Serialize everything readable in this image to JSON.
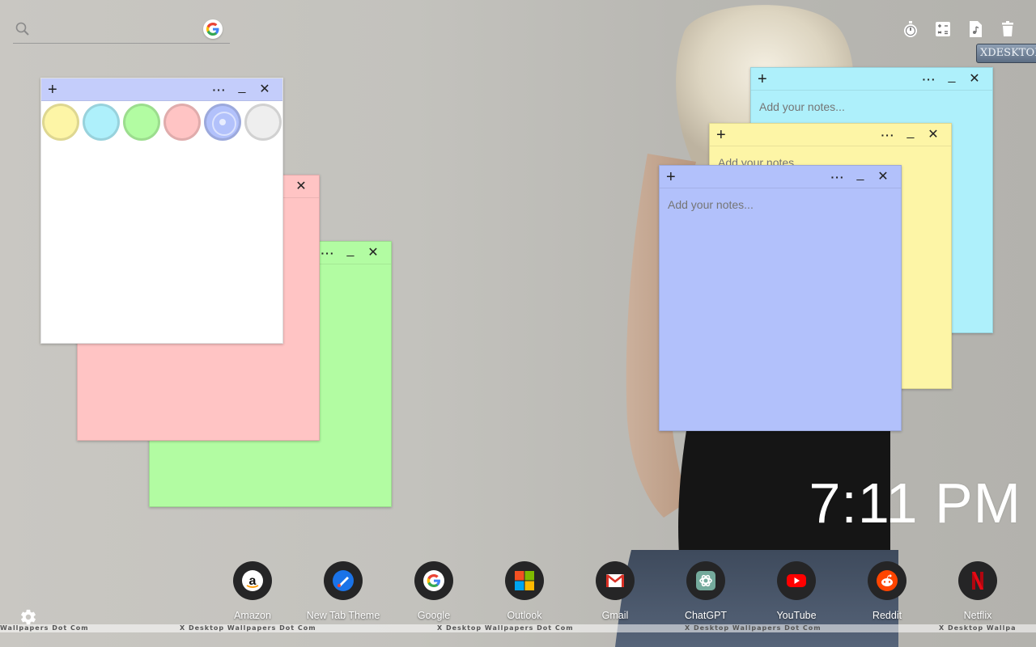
{
  "search": {
    "placeholder": ""
  },
  "watermark": {
    "logo": "XDESKTOP WALLPAPERS",
    "texts": [
      "Wallpapers Dot Com",
      "X Desktop Wallpapers Dot Com",
      "X Desktop Wallpapers Dot Com",
      "X Desktop Wallpapers Dot Com",
      "X Desktop Wallpa"
    ]
  },
  "top_tools": [
    "stopwatch-icon",
    "calculator-icon",
    "file-music-icon",
    "trash-icon"
  ],
  "notes": {
    "placeholder": "Add your notes...",
    "add": "+",
    "more": "···",
    "minimize": "_",
    "close": "✕"
  },
  "color_picker": {
    "colors": [
      "#fdf5a6",
      "#aef0fb",
      "#b2fca2",
      "#ffc4c4",
      "#b2c1fb",
      "#eeeeee"
    ],
    "selected": "#b2c1fb"
  },
  "clock": {
    "time": "7:11 PM"
  },
  "dock": {
    "items": [
      {
        "label": "Amazon",
        "icon": "amazon-icon"
      },
      {
        "label": "New Tab Theme",
        "icon": "new-tab-theme-icon"
      },
      {
        "label": "Google",
        "icon": "google-icon"
      },
      {
        "label": "Outlook",
        "icon": "outlook-icon"
      },
      {
        "label": "Gmail",
        "icon": "gmail-icon"
      },
      {
        "label": "ChatGPT",
        "icon": "chatgpt-icon"
      },
      {
        "label": "YouTube",
        "icon": "youtube-icon"
      },
      {
        "label": "Reddit",
        "icon": "reddit-icon"
      },
      {
        "label": "Netflix",
        "icon": "netflix-icon"
      }
    ]
  }
}
